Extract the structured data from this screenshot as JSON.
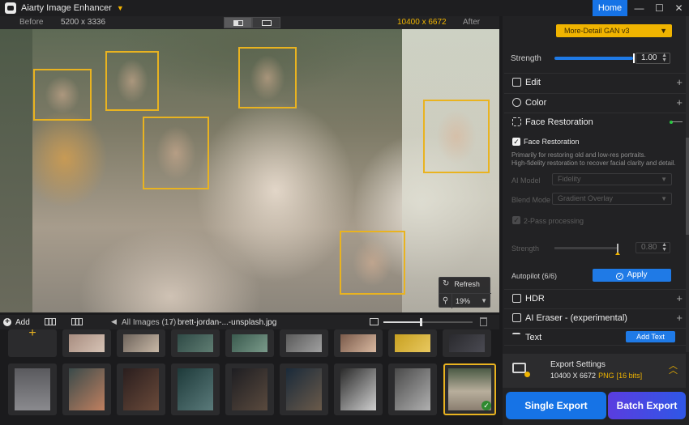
{
  "titlebar": {
    "app_title": "Aiarty Image Enhancer",
    "home_label": "Home",
    "minimize": "—",
    "maximize": "☐",
    "close": "✕"
  },
  "compare": {
    "before_label": "Before",
    "before_size": "5200 x 3336",
    "after_size": "10400 x 6672",
    "after_label": "After"
  },
  "viewer": {
    "refresh_label": "Refresh",
    "zoom_value": "19%"
  },
  "library": {
    "add_label": "Add",
    "all_images_label": "All Images (17)",
    "separator": "/",
    "current_file": "brett-jordan-...-unsplash.jpg",
    "thumbnail_size_fraction": 0.42
  },
  "panel": {
    "ai_model_value": "More-Detail GAN  v3",
    "strength_label": "Strength",
    "strength_value": "1.00",
    "strength_fraction": 1.0,
    "sections": {
      "edit": "Edit",
      "color": "Color",
      "face_restoration": "Face Restoration",
      "hdr": "HDR",
      "ai_eraser": "AI Eraser - (experimental)",
      "text": "Text"
    },
    "face_restoration": {
      "enabled_label": "Face Restoration",
      "description_line1": "Primarily for restoring old and low-res portraits.",
      "description_line2": "High-fidelity restoration to recover facial clarity and detail.",
      "ai_model_label": "AI Model",
      "ai_model_value": "Fidelity",
      "blend_mode_label": "Blend Mode",
      "blend_mode_value": "Gradient Overlay",
      "two_pass_label": "2-Pass processing",
      "strength_label": "Strength",
      "strength_value": "0.80",
      "strength_fraction": 0.8,
      "autopilot_label": "Autopilot (6/6)",
      "apply_label": "Apply"
    },
    "add_text_label": "Add Text"
  },
  "export": {
    "title": "Export Settings",
    "resolution": "10400 X 6672",
    "format": "PNG",
    "bits": "[16 bits]",
    "single_label": "Single Export",
    "batch_label": "Batch Export"
  },
  "colors": {
    "accent_blue": "#1f7ae6",
    "face_box_yellow": "#e9b320",
    "model_select_yellow": "#f0b400",
    "active_dot_green": "#28c940"
  }
}
